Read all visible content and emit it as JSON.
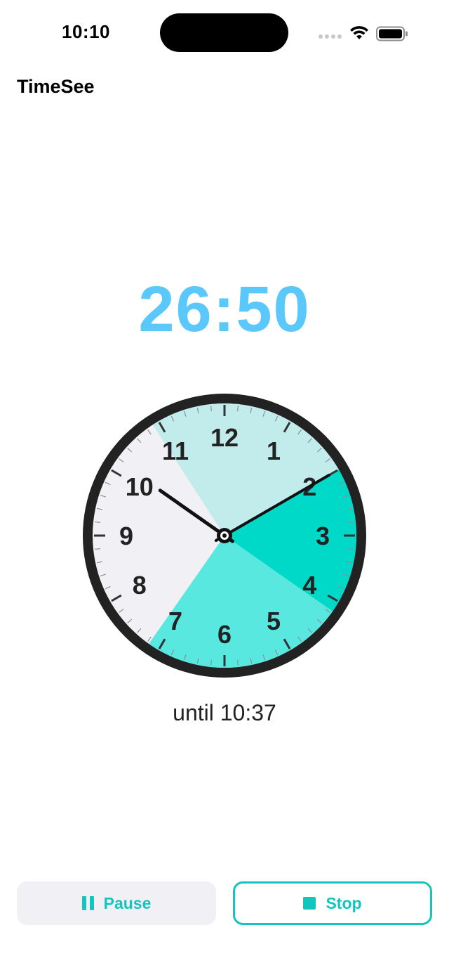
{
  "status_bar": {
    "time": "10:10"
  },
  "app": {
    "title": "TimeSee"
  },
  "timer": {
    "remaining": "26:50",
    "until_label": "until 10:37",
    "colors": {
      "countdown": "#5ac8fa",
      "accent": "#12c6c0",
      "sector_past": "#c2ecec",
      "sector_remaining": "#00d9c8",
      "sector_future_light": "#58e8e0",
      "sector_idle": "#f0f0f5",
      "bezel": "#222222"
    }
  },
  "clock": {
    "numerals": [
      "12",
      "1",
      "2",
      "3",
      "4",
      "5",
      "6",
      "7",
      "8",
      "9",
      "10",
      "11"
    ],
    "hour_hand_time": "10:10",
    "minute_hand_minute": 10
  },
  "controls": {
    "pause_label": "Pause",
    "stop_label": "Stop"
  },
  "icons": {
    "wifi": "wifi-icon",
    "battery": "battery-icon",
    "pause": "pause-icon",
    "stop": "stop-icon"
  }
}
